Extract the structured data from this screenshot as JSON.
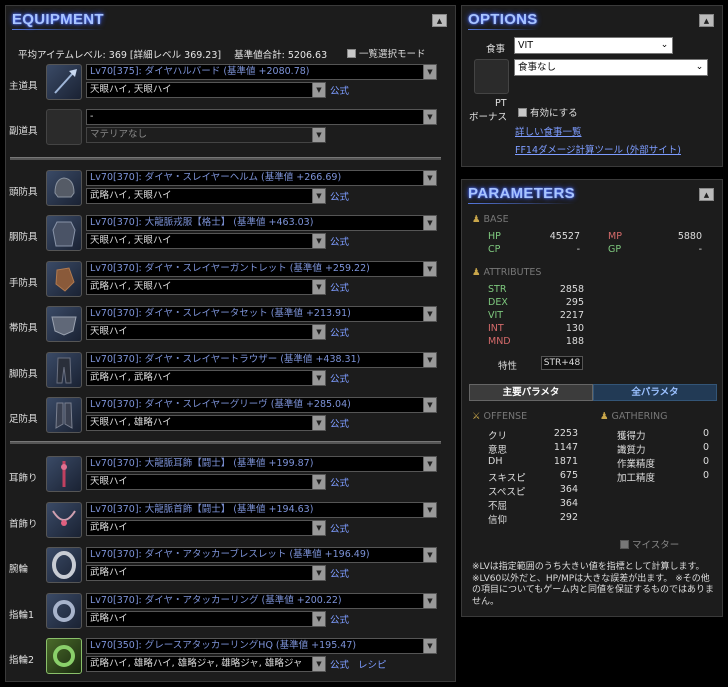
{
  "equipment": {
    "title": "EQUIPMENT",
    "summary": {
      "avg_level": "平均アイテムレベル: 369 [詳細レベル 369.23]",
      "base_total": "基準値合計: 5206.63",
      "select_mode": "一覧選択モード"
    },
    "slots": [
      {
        "label": "主道具",
        "item": "Lv70[375]: ダイヤハルバード (基準値 +2080.78)",
        "melds": "天眼ハイ, 天眼ハイ",
        "link": "公式",
        "icon": "halberd-icon"
      },
      {
        "label": "副道具",
        "item": "-",
        "melds": "マテリアなし",
        "link": "",
        "icon": "empty-slot-icon"
      },
      {
        "label": "頭防具",
        "item": "Lv70[370]: ダイヤ・スレイヤーヘルム (基準値 +266.69)",
        "melds": "武略ハイ, 天眼ハイ",
        "link": "公式",
        "icon": "helm-icon"
      },
      {
        "label": "胴防具",
        "item": "Lv70[370]: 大龍脈戎服【格士】 (基準値 +463.03)",
        "melds": "天眼ハイ, 天眼ハイ",
        "link": "公式",
        "icon": "body-armor-icon"
      },
      {
        "label": "手防具",
        "item": "Lv70[370]: ダイヤ・スレイヤーガントレット (基準値 +259.22)",
        "melds": "武略ハイ, 天眼ハイ",
        "link": "公式",
        "icon": "gauntlet-icon"
      },
      {
        "label": "帯防具",
        "item": "Lv70[370]: ダイヤ・スレイヤータセット (基準値 +213.91)",
        "melds": "天眼ハイ",
        "link": "公式",
        "icon": "tasset-icon"
      },
      {
        "label": "脚防具",
        "item": "Lv70[370]: ダイヤ・スレイヤートラウザー (基準値 +438.31)",
        "melds": "武略ハイ, 武略ハイ",
        "link": "公式",
        "icon": "trousers-icon"
      },
      {
        "label": "足防具",
        "item": "Lv70[370]: ダイヤ・スレイヤーグリーヴ (基準値 +285.04)",
        "melds": "天眼ハイ, 雄略ハイ",
        "link": "公式",
        "icon": "greaves-icon"
      },
      {
        "label": "耳飾り",
        "item": "Lv70[370]: 大龍脈耳飾【闘士】 (基準値 +199.87)",
        "melds": "天眼ハイ",
        "link": "公式",
        "icon": "earring-icon"
      },
      {
        "label": "首飾り",
        "item": "Lv70[370]: 大龍脈首飾【闘士】 (基準値 +194.63)",
        "melds": "武略ハイ",
        "link": "公式",
        "icon": "necklace-icon"
      },
      {
        "label": "腕輪",
        "item": "Lv70[370]: ダイヤ・アタッカーブレスレット (基準値 +196.49)",
        "melds": "武略ハイ",
        "link": "公式",
        "icon": "bracelet-icon"
      },
      {
        "label": "指輪1",
        "item": "Lv70[370]: ダイヤ・アタッカーリング (基準値 +200.22)",
        "melds": "武略ハイ",
        "link": "公式",
        "icon": "ring-icon"
      },
      {
        "label": "指輪2",
        "item": "Lv70[350]: グレースアタッカーリングHQ (基準値 +195.47)",
        "melds": "武略ハイ, 雄略ハイ, 雄略ジャ, 雄略ジャ, 雄略ジャ",
        "link": "公式",
        "link2": "レシピ",
        "icon": "ring-hq-icon"
      }
    ]
  },
  "options": {
    "title": "OPTIONS",
    "meal_label": "食事",
    "meal_value": "VIT",
    "food_value": "食事なし",
    "pt_bonus_label_1": "PT",
    "pt_bonus_label_2": "ボーナス",
    "enable_label": "有効にする",
    "meal_list_link": "詳しい食事一覧",
    "dmg_tool_link": "FF14ダメージ計算ツール (外部サイト)"
  },
  "parameters": {
    "title": "PARAMETERS",
    "base_head": "BASE",
    "base": {
      "hp_label": "HP",
      "hp": "45527",
      "mp_label": "MP",
      "mp": "5880",
      "cp_label": "CP",
      "cp": "-",
      "gp_label": "GP",
      "gp": "-"
    },
    "attr_head": "ATTRIBUTES",
    "attributes": [
      {
        "name": "STR",
        "value": "2858"
      },
      {
        "name": "DEX",
        "value": "295"
      },
      {
        "name": "VIT",
        "value": "2217"
      },
      {
        "name": "INT",
        "value": "130"
      },
      {
        "name": "MND",
        "value": "188"
      }
    ],
    "trait_label": "特性",
    "trait_value": "STR+48",
    "tab_main": "主要パラメタ",
    "tab_all": "全パラメタ",
    "offense_head": "OFFENSE",
    "offense": [
      {
        "name": "クリ",
        "value": "2253"
      },
      {
        "name": "意思",
        "value": "1147"
      },
      {
        "name": "DH",
        "value": "1871"
      },
      {
        "name": "スキスピ",
        "value": "675"
      },
      {
        "name": "スペスピ",
        "value": "364"
      },
      {
        "name": "不屈",
        "value": "364"
      },
      {
        "name": "信仰",
        "value": "292"
      }
    ],
    "gathering_head": "GATHERING",
    "gathering": [
      {
        "name": "獲得力",
        "value": "0"
      },
      {
        "name": "識質力",
        "value": "0"
      },
      {
        "name": "作業精度",
        "value": "0"
      },
      {
        "name": "加工精度",
        "value": "0"
      }
    ],
    "master_label": "マイスター",
    "note": "※LVは指定範囲のうち大きい値を指標として計算します。 ※LV60以外だと、HP/MPは大きな誤差が出ます。 ※その他の項目についてもゲーム内と同値を保証するものではありません。"
  },
  "colors": {
    "title_blue": "#a8c4ff",
    "link_blue": "#7d9cff",
    "attr_green": "#7ec87e",
    "attr_red": "#d46a6a",
    "gold": "#c9a64a"
  }
}
